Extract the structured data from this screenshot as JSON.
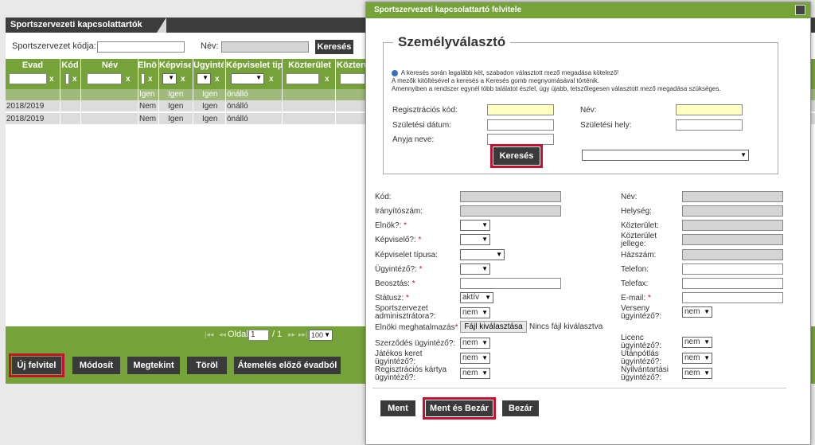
{
  "background": {
    "title": "Sportszervezeti kapcsolattartók",
    "search": {
      "code_label": "Sportszervezet kódja:",
      "name_label": "Név:",
      "search_button": "Keresés"
    },
    "columns": [
      "Evad",
      "Kód",
      "Név",
      "Elnö",
      "Képvise",
      "Ugyinté",
      "Képviselet tip",
      "Közterület",
      "Közterü"
    ],
    "filter_x": "x",
    "subheader": [
      "Igen",
      "Igen",
      "Igen",
      "önálló"
    ],
    "rows": [
      {
        "evad": "2018/2019",
        "elnok": "Nem",
        "kepv": "Igen",
        "ugy": "Igen",
        "tip": "önálló"
      },
      {
        "evad": "2018/2019",
        "elnok": "Nem",
        "kepv": "Igen",
        "ugy": "Igen",
        "tip": "önálló"
      }
    ],
    "pager": {
      "first": "|◂◂",
      "prev": "◂◂",
      "page_label": "Oldal",
      "page_value": "1",
      "of": "/ 1",
      "next": "▸▸",
      "last": "▸▸|",
      "page_size": "100"
    },
    "buttons": {
      "new": "Új felvitel",
      "edit": "Módosít",
      "view": "Megtekint",
      "delete": "Töröl",
      "carry": "Átemelés előző évadból"
    }
  },
  "modal": {
    "title": "Sportszervezeti kapcsolattartó felvitele",
    "legend": "Személyválasztó",
    "notes": [
      "A keresés során legalább kët, szabadon választott mező megadása kötelező!",
      "A mezők kitöltésével a keresés a Keresés gomb megnyomásával történik.",
      "Amennyiben a rendszer egynél több találatot észlel, úgy újabb, tetszőlegesen választott mező megadása szükséges."
    ],
    "person_search": {
      "reg_code": "Regisztrációs kód:",
      "name": "Név:",
      "birth_date": "Születési dátum:",
      "birth_place": "Születési hely:",
      "mother_name": "Anyja neve:",
      "search_button": "Keresés"
    },
    "form": {
      "kod": "Kód:",
      "nev": "Név:",
      "irsz": "Irányítószám:",
      "helyseg": "Helység:",
      "elnok": "Elnök?:",
      "kozterulet": "Közterület:",
      "kepviselo": "Képviselő?:",
      "kozterulet_jellege": "Közterület jellege:",
      "kepviselet_tipusa": "Képviselet típusa:",
      "hazszam": "Házszám:",
      "ugyintezo": "Ügyintéző?:",
      "telefon": "Telefon:",
      "beosztas": "Beosztás:",
      "telefax": "Telefax:",
      "statusz": "Státusz:",
      "statusz_value": "aktív",
      "email": "E-mail:",
      "sportszervezet_admin": "Sportszervezet adminisztrátora?:",
      "verseny_ugyintezo": "Verseny ügyintéző?:",
      "elnoki_meghatalmazas": "Elnöki meghatalmazás",
      "file_button": "Fájl kiválasztása",
      "no_file": "Nincs fájl kiválasztva",
      "szerzodes_ugyintezo": "Szerződés ügyintéző?:",
      "licenc_ugyintezo": "Licenc ügyintéző?:",
      "jatekos_keret": "Játékos keret ügyintéző?:",
      "utanpotlas": "Utánpótlás ügyintéző?:",
      "reg_kartya": "Regisztrációs kártya ügyintéző?:",
      "nyilvantartasi": "Nyilvántartási ügyintéző?:",
      "nem": "nem",
      "required_mark": "*"
    },
    "buttons": {
      "save": "Ment",
      "save_close": "Ment és Bezár",
      "close": "Bezár"
    }
  }
}
